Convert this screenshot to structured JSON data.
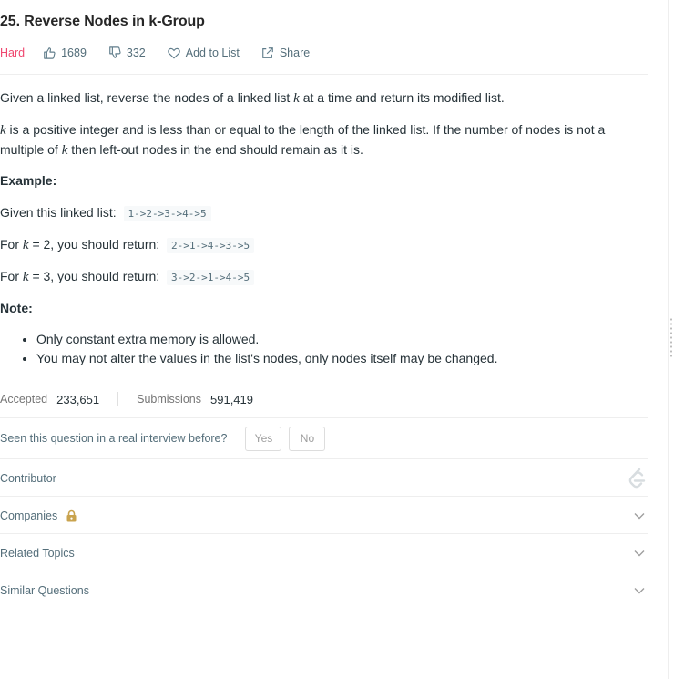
{
  "problem": {
    "title": "25. Reverse Nodes in k-Group",
    "difficulty": "Hard",
    "likes": "1689",
    "dislikes": "332",
    "add_to_list": "Add to List",
    "share": "Share"
  },
  "description": {
    "p1_a": "Given a linked list, reverse the nodes of a linked list ",
    "k": "k",
    "p1_b": " at a time and return its modified list.",
    "p2_a": " is a positive integer and is less than or equal to the length of the linked list. If the number of nodes is not a multiple of ",
    "p2_b": " then left-out nodes in the end should remain as it is.",
    "example_heading": "Example:",
    "given_text": "Given this linked list:",
    "given_code": "1->2->3->4->5",
    "for": "For ",
    "k2_text": " = 2, you should return:",
    "k2_code": "2->1->4->3->5",
    "k3_text": " = 3, you should return:",
    "k3_code": "3->2->1->4->5",
    "note_heading": "Note:",
    "notes": [
      "Only constant extra memory is allowed.",
      "You may not alter the values in the list's nodes, only nodes itself may be changed."
    ]
  },
  "stats": {
    "accepted_label": "Accepted",
    "accepted_value": "233,651",
    "submissions_label": "Submissions",
    "submissions_value": "591,419"
  },
  "interview": {
    "question": "Seen this question in a real interview before?",
    "yes": "Yes",
    "no": "No"
  },
  "sections": {
    "contributor": "Contributor",
    "companies": "Companies",
    "related_topics": "Related Topics",
    "similar_questions": "Similar Questions"
  },
  "colors": {
    "hard": "#ef476f",
    "lock": "#c9a34e",
    "muted": "#546e7a"
  }
}
